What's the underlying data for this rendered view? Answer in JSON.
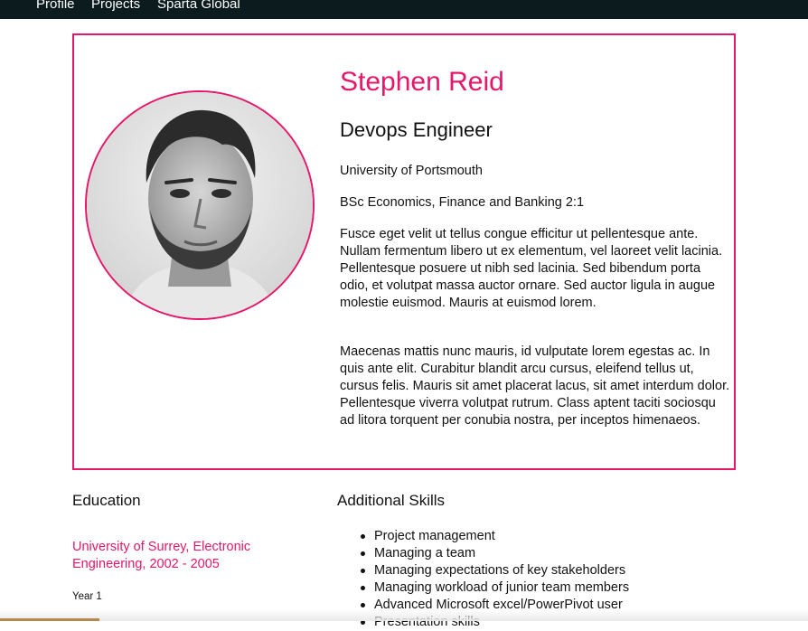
{
  "nav": {
    "items": [
      "Profile",
      "Projects",
      "Sparta Global"
    ]
  },
  "profile": {
    "name": "Stephen Reid",
    "role": "Devops Engineer",
    "university": "University of Portsmouth",
    "degree": "BSc Economics, Finance and Banking 2:1",
    "para1": "Fusce eget velit ut tellus congue efficitur ut pellentesque ante. Nullam fermentum libero ut ex elementum, vel laoreet velit lacinia. Pellentesque posuere ut nibh sed lacinia. Sed bibendum porta odio, et volutpat massa auctor ornare. Sed auctor ligula in augue molestie euismod. Mauris at euismod lorem.",
    "para2": "Maecenas mattis nunc mauris, id vulputate lorem egestas ac. In quis ante elit. Curabitur blandit arcu cursus, eleifend tellus ut, cursus felis. Mauris sit amet placerat lacus, sit amet interdum dolor. Pellentesque viverra volutpat rutrum. Class aptent taciti sociosqu ad litora torquent per conubia nostra, per inceptos himenaeos."
  },
  "education": {
    "title": "Education",
    "item": "University of Surrey, Electronic Engineering, 2002 - 2005",
    "year_label": "Year 1"
  },
  "skills": {
    "title": "Additional Skills",
    "items": [
      "Project management",
      "Managing a team",
      "Managing expectations of key stakeholders",
      "Managing workload of junior team members",
      "Advanced Microsoft excel/PowerPivot user",
      "Presentation skills"
    ]
  },
  "colors": {
    "accent": "#e5176a",
    "navbar": "#0b1b1e"
  }
}
